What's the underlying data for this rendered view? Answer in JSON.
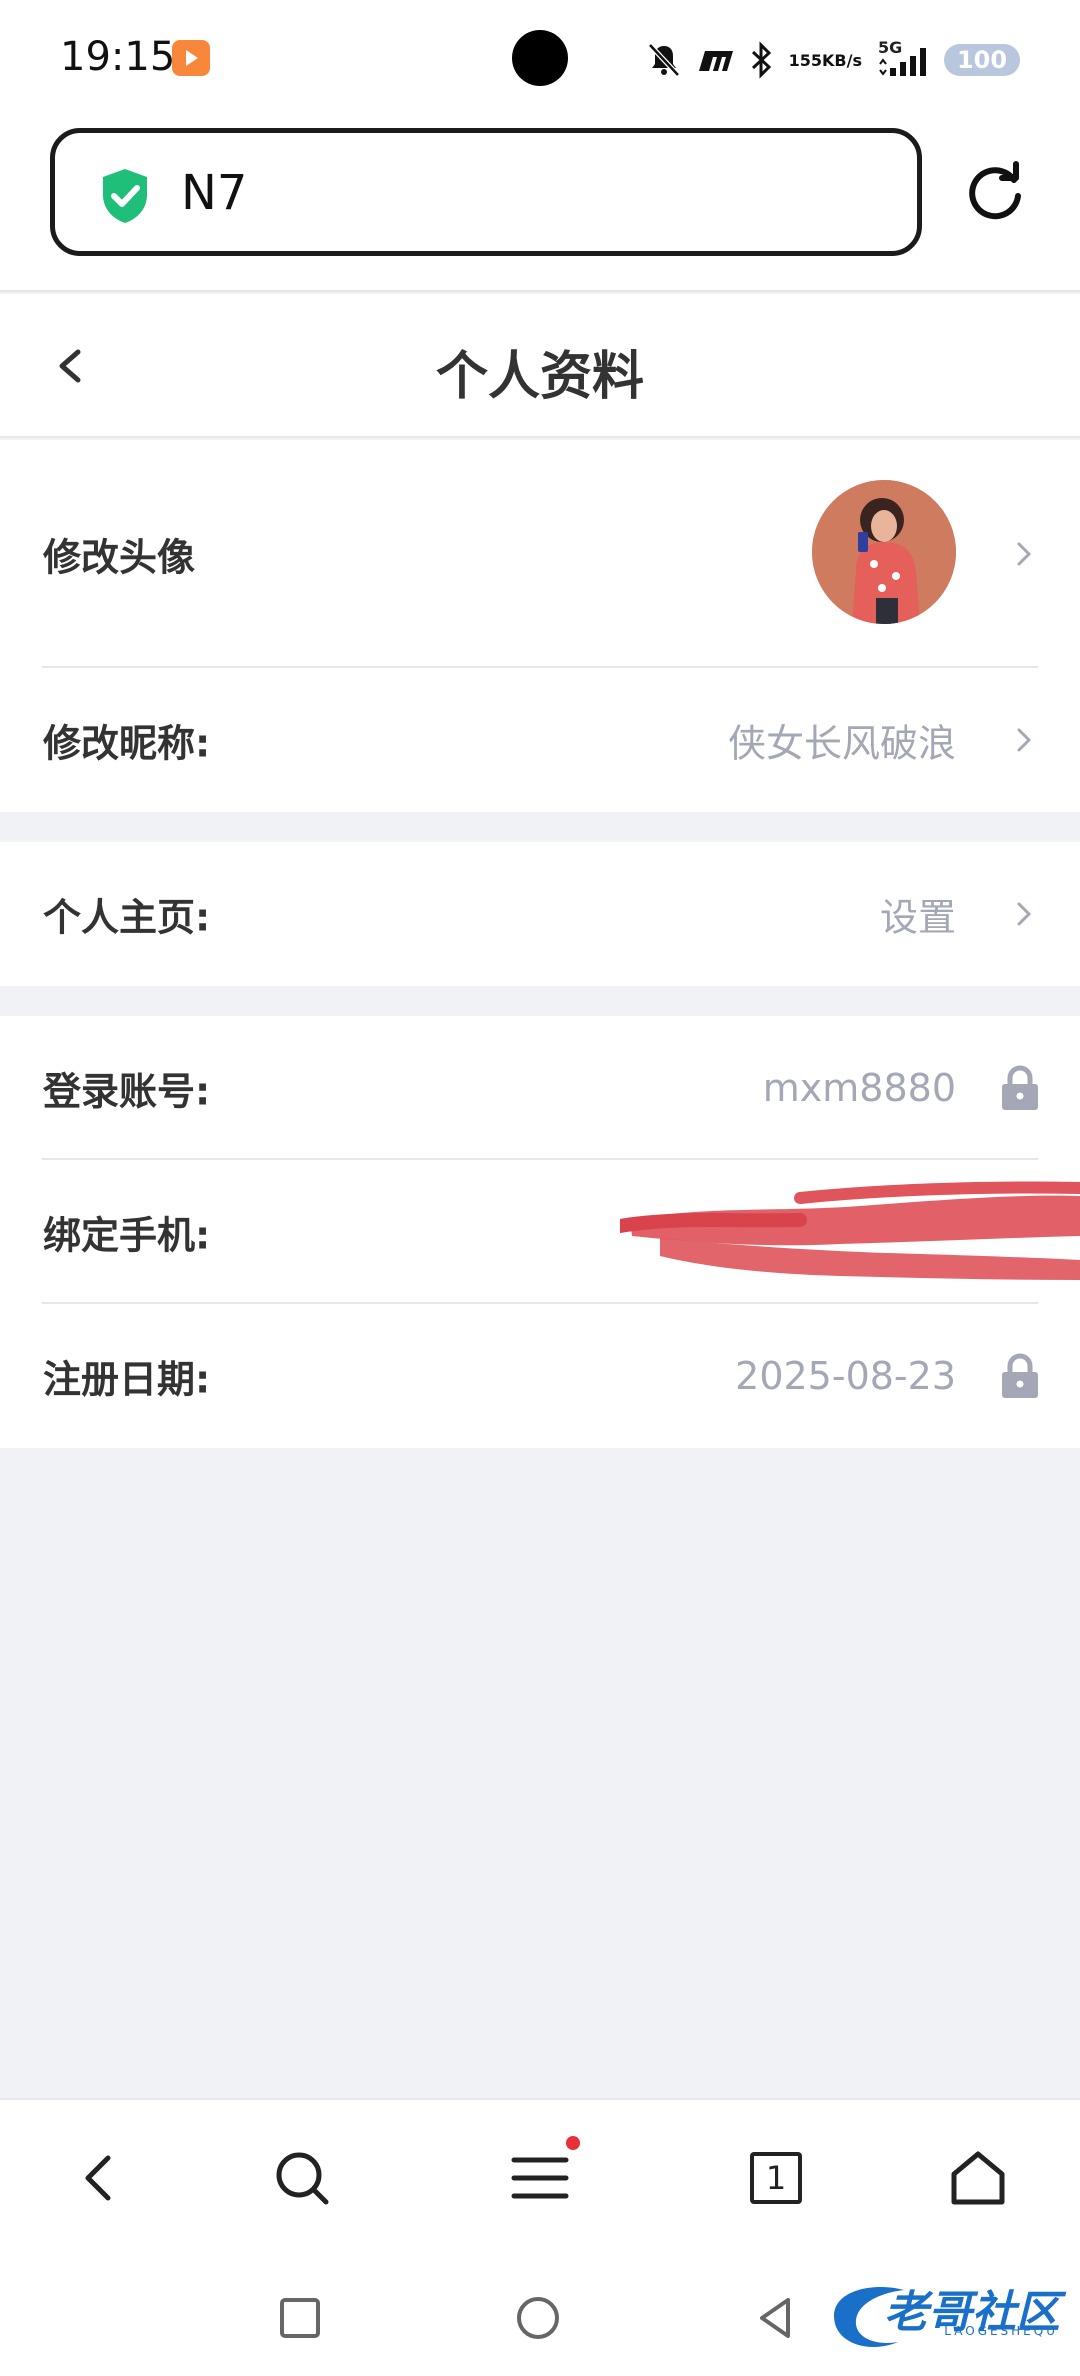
{
  "status_bar": {
    "time": "19:15",
    "net_speed_value": "155",
    "net_speed_unit": "KB/s",
    "network": "5G",
    "battery": "100"
  },
  "browser": {
    "url_text": "N7"
  },
  "header": {
    "title": "个人资料"
  },
  "profile": {
    "avatar_label": "修改头像",
    "nickname_label": "修改昵称:",
    "nickname_value": "侠女长风破浪",
    "homepage_label": "个人主页:",
    "homepage_value": "设置",
    "account_label": "登录账号:",
    "account_value": "mxm8880",
    "phone_label": "绑定手机:",
    "register_label": "注册日期:",
    "register_value": "2025-08-23"
  },
  "toolbar": {
    "tab_count": "1"
  },
  "watermark": {
    "text": "老哥社区",
    "sub": "LAOGESHEQU"
  },
  "colors": {
    "accent_green": "#1fbf7a",
    "muted_text": "#a4a8b6",
    "background": "#f1f2f6",
    "redaction": "#e0545c"
  }
}
